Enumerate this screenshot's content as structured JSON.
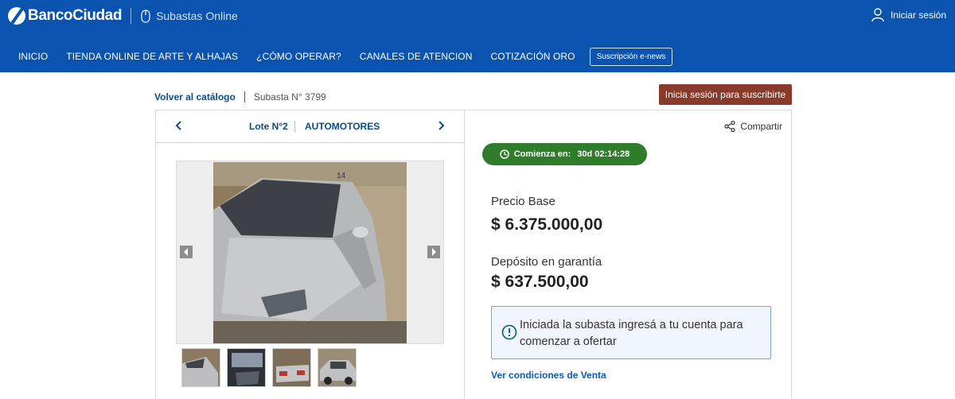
{
  "header": {
    "brand": "BancoCiudad",
    "section_title": "Subastas Online",
    "login_label": "Iniciar sesión"
  },
  "nav": {
    "items": [
      {
        "label": "INICIO"
      },
      {
        "label": "TIENDA ONLINE DE ARTE Y ALHAJAS"
      },
      {
        "label": "¿CÓMO OPERAR?"
      },
      {
        "label": "CANALES DE ATENCION"
      },
      {
        "label": "COTIZACIÓN ORO"
      }
    ],
    "subscription_label": "Suscripción e-news"
  },
  "breadcrumb": {
    "back_label": "Volver al catálogo",
    "current": "Subasta N° 3799"
  },
  "subscribe_button": "Inicia sesión para suscribirte",
  "lot": {
    "label": "Lote N°2",
    "category": "AUTOMOTORES"
  },
  "gallery": {
    "main_image": "silver-sedan-car-photo",
    "thumbnail_count": 4,
    "thumbnails": [
      "car-front-photo",
      "car-interior-photo",
      "car-rear-photo",
      "car-side-photo"
    ]
  },
  "detail": {
    "share_label": "Compartir",
    "countdown": {
      "label": "Comienza en:",
      "value": "30d 02:14:28",
      "color": "#2f7d2a"
    },
    "base_price_label": "Precio Base",
    "base_price_value": "$ 6.375.000,00",
    "deposit_label": "Depósito en garantía",
    "deposit_value": "$ 637.500,00",
    "info_message": "Iniciada la subasta ingresá a tu cuenta para comenzar a ofertar",
    "conditions_link": "Ver condiciones de Venta"
  },
  "colors": {
    "header_blue": "#0a54b0",
    "link_blue": "#0a4c8c",
    "subscribe_brown": "#8a3a2a",
    "countdown_green": "#2f7d2a"
  }
}
